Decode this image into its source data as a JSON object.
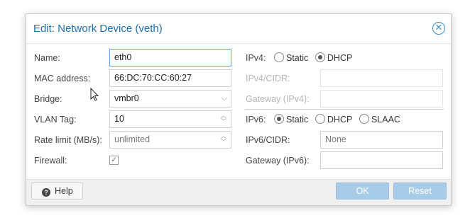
{
  "dialog": {
    "title": "Edit: Network Device (veth)",
    "close_icon": "close-circle-icon"
  },
  "left": {
    "name": {
      "label": "Name:",
      "value": "eth0"
    },
    "mac": {
      "label": "MAC address:",
      "value": "66:DC:70:CC:60:27"
    },
    "bridge": {
      "label": "Bridge:",
      "value": "vmbr0"
    },
    "vlan": {
      "label": "VLAN Tag:",
      "value": "10"
    },
    "rate": {
      "label": "Rate limit (MB/s):",
      "value": "unlimited"
    },
    "firewall": {
      "label": "Firewall:",
      "checked": true
    }
  },
  "right": {
    "ipv4": {
      "label": "IPv4:",
      "options": [
        "Static",
        "DHCP"
      ],
      "selected": "DHCP"
    },
    "ipv4_cidr": {
      "label": "IPv4/CIDR:",
      "value": ""
    },
    "gateway4": {
      "label": "Gateway (IPv4):",
      "value": ""
    },
    "ipv6": {
      "label": "IPv6:",
      "options": [
        "Static",
        "DHCP",
        "SLAAC"
      ],
      "selected": "Static"
    },
    "ipv6_cidr": {
      "label": "IPv6/CIDR:",
      "value": "None"
    },
    "gateway6": {
      "label": "Gateway (IPv6):",
      "value": ""
    }
  },
  "footer": {
    "help_label": "Help",
    "ok_label": "OK",
    "reset_label": "Reset"
  },
  "colors": {
    "title": "#1f6ea8",
    "primary_disabled": "#a8cbe8",
    "focus_border": "#5fa2dd"
  }
}
